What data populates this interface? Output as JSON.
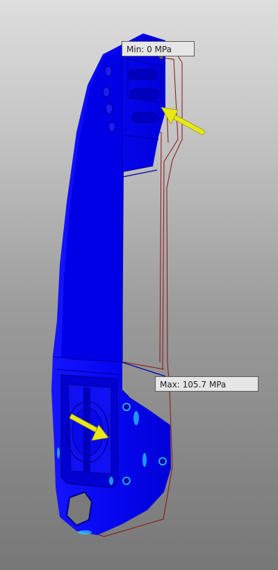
{
  "view": {
    "background_top": "#dedede",
    "background_bottom": "#777777"
  },
  "model": {
    "stress_color": "#0a0aff",
    "hot_spot_color": "#2fd3ff",
    "outline_color": "#8b1010",
    "load_arrow_color": "#e8e817"
  },
  "probes": {
    "min_text": "Min: 0 MPa",
    "max_text": "Max: 105.7 MPa"
  }
}
